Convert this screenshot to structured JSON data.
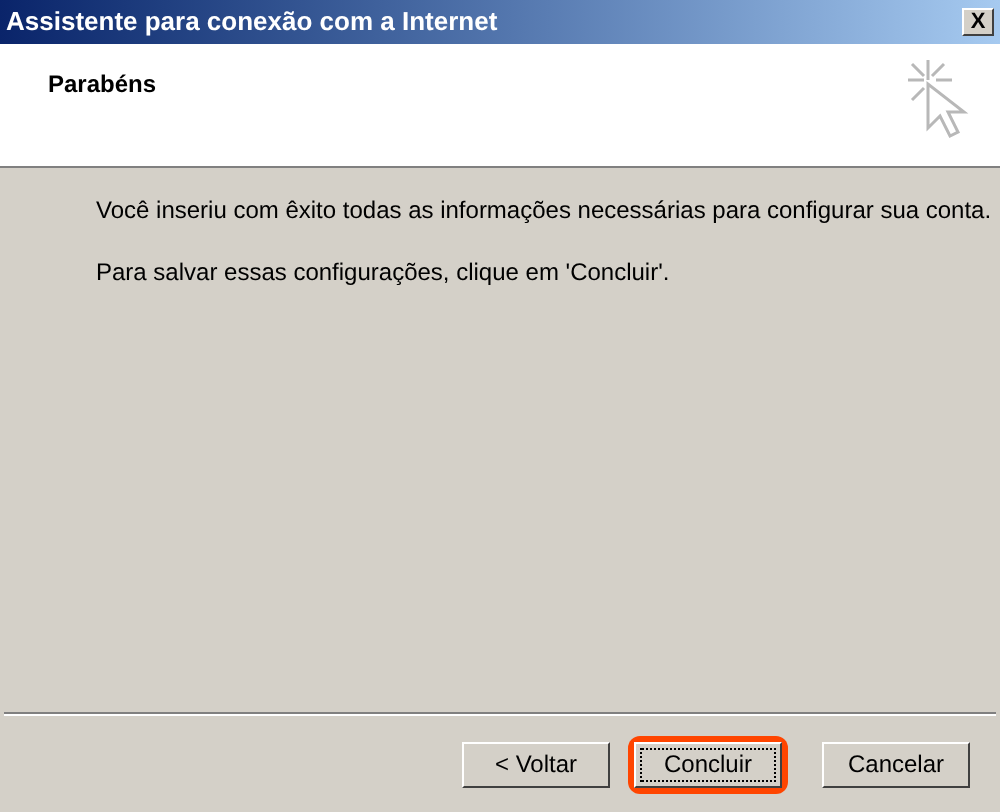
{
  "window": {
    "title": "Assistente para conexão com a Internet",
    "close": "X"
  },
  "header": {
    "title": "Parabéns"
  },
  "body": [
    "Você inseriu com êxito todas as informações necessárias para configurar sua conta.",
    "Para salvar essas configurações, clique em 'Concluir'."
  ],
  "buttons": [
    {
      "label": "< Voltar",
      "focused": false,
      "highlighted": false
    },
    {
      "label": "Concluir",
      "focused": true,
      "highlighted": true
    },
    {
      "label": "Cancelar",
      "focused": false,
      "highlighted": false
    }
  ]
}
